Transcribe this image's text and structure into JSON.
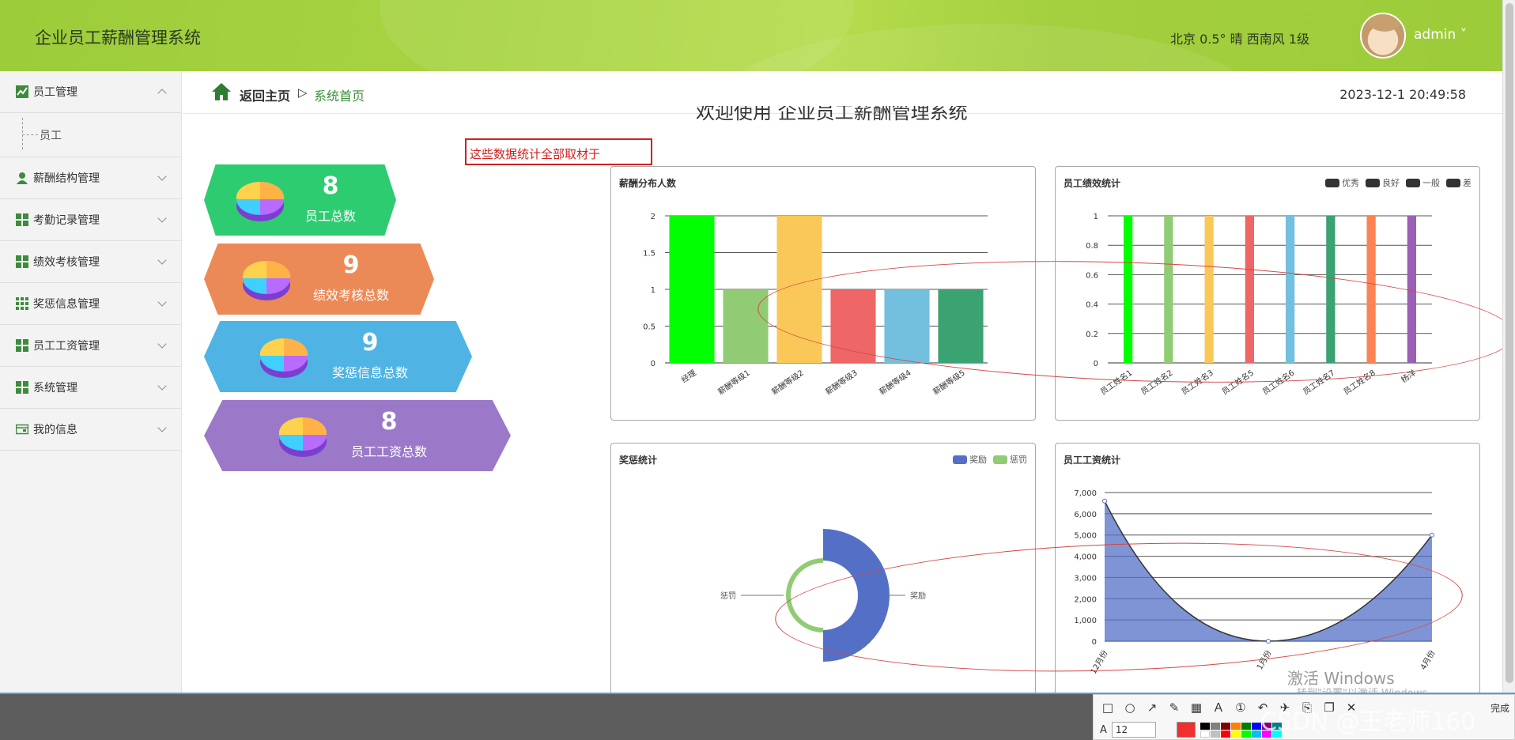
{
  "header": {
    "app_title": "企业员工薪酬管理系统",
    "weather": "北京  0.5°  晴  西南风  1级",
    "user": "admin ˅"
  },
  "sidebar": {
    "items": [
      {
        "label": "员工管理",
        "icon": "chart-icon",
        "expanded": true
      },
      {
        "label": "薪酬结构管理",
        "icon": "user-icon"
      },
      {
        "label": "考勤记录管理",
        "icon": "grid-icon"
      },
      {
        "label": "绩效考核管理",
        "icon": "grid-icon"
      },
      {
        "label": "奖惩信息管理",
        "icon": "grid9-icon"
      },
      {
        "label": "员工工资管理",
        "icon": "grid-icon"
      },
      {
        "label": "系统管理",
        "icon": "grid-icon"
      },
      {
        "label": "我的信息",
        "icon": "card-icon"
      }
    ],
    "sub_item": "员工"
  },
  "breadcrumb": {
    "home": "返回主页",
    "sep": "▷",
    "current": "系统首页"
  },
  "clock": "2023-12-1  20:49:58",
  "welcome": "欢迎使用 企业员工薪酬管理系统",
  "annotation": "这些数据统计全部取材于",
  "stats": [
    {
      "value": "8",
      "label": "员工总数",
      "color": "#2ecc71"
    },
    {
      "value": "9",
      "label": "绩效考核总数",
      "color": "#ec8a57"
    },
    {
      "value": "9",
      "label": "奖惩信息总数",
      "color": "#4fb4e3"
    },
    {
      "value": "8",
      "label": "员工工资总数",
      "color": "#9b79c8"
    }
  ],
  "watermark": {
    "line1": "激活 Windows",
    "line2": "转到\"设置\"以激活 Windows。"
  },
  "snip": {
    "done": "完成",
    "size": "12",
    "font_label": "A"
  },
  "csdn": "CSDN @王老师160",
  "chart_data": [
    {
      "type": "bar",
      "title": "薪酬分布人数",
      "categories": [
        "经理",
        "薪酬等级1",
        "薪酬等级2",
        "薪酬等级3",
        "薪酬等级4",
        "薪酬等级5"
      ],
      "values": [
        2,
        1,
        2,
        1,
        1,
        1
      ],
      "colors": [
        "#00ff00",
        "#91cc75",
        "#fac858",
        "#ee6666",
        "#73c0de",
        "#3ba272"
      ],
      "ylim": [
        0,
        2
      ],
      "yticks": [
        "0",
        "0.5",
        "1",
        "1.5",
        "2"
      ]
    },
    {
      "type": "bar",
      "title": "员工绩效统计",
      "legend": [
        "优秀",
        "良好",
        "一般",
        "差"
      ],
      "categories": [
        "员工姓名1",
        "员工姓名2",
        "员工姓名3",
        "员工姓名5",
        "员工姓名6",
        "员工姓名7",
        "员工姓名8",
        "杨洋"
      ],
      "values": [
        1,
        1,
        1,
        1,
        1,
        1,
        1,
        1
      ],
      "colors": [
        "#00ff00",
        "#91cc75",
        "#fac858",
        "#ee6666",
        "#73c0de",
        "#3ba272",
        "#fc8452",
        "#9a60b4"
      ],
      "ylim": [
        0,
        1
      ],
      "yticks": [
        "0",
        "0.2",
        "0.4",
        "0.6",
        "0.8",
        "1"
      ]
    },
    {
      "type": "pie",
      "title": "奖惩统计",
      "legend": [
        "奖励",
        "惩罚"
      ],
      "slices": [
        {
          "name": "奖励",
          "value": 8,
          "color": "#5470c6"
        },
        {
          "name": "惩罚",
          "value": 1,
          "color": "#91cc75"
        }
      ]
    },
    {
      "type": "area",
      "title": "员工工资统计",
      "categories": [
        "12月份",
        "1月份",
        "4月份"
      ],
      "values": [
        6600,
        0,
        5000
      ],
      "ylim": [
        0,
        7000
      ],
      "yticks": [
        "0",
        "1,000",
        "2,000",
        "3,000",
        "4,000",
        "5,000",
        "6,000",
        "7,000"
      ]
    }
  ]
}
